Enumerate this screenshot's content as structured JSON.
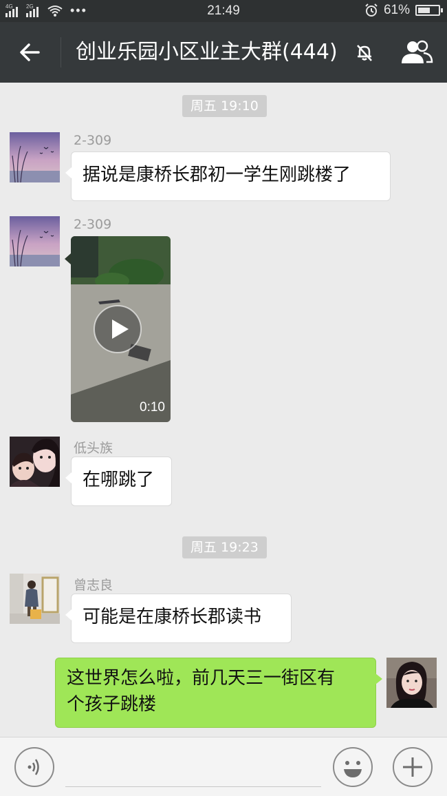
{
  "status_bar": {
    "net1": "4G",
    "net2": "2G",
    "more": "•••",
    "time": "21:49",
    "battery": "61%",
    "battery_level": 0.61
  },
  "header": {
    "title": "创业乐园小区业主大群(444)"
  },
  "timestamps": [
    "周五 19:10",
    "周五 19:23"
  ],
  "messages": [
    {
      "sender": "2-309",
      "text": "据说是康桥长郡初一学生刚跳楼了"
    },
    {
      "sender": "2-309",
      "video_duration": "0:10"
    },
    {
      "sender": "低头族",
      "text": "在哪跳了"
    },
    {
      "sender": "曾志良",
      "text": "可能是在康桥长郡读书"
    },
    {
      "sender": "",
      "text_line1": "这世界怎么啦，前几天三一街区有",
      "text_line2": "个孩子跳楼"
    }
  ],
  "colors": {
    "header_bg": "#35393b",
    "chat_bg": "#ebebeb",
    "my_bubble": "#9fe657",
    "other_bubble": "#ffffff"
  },
  "icons": [
    "back-arrow-icon",
    "mute-bell-icon",
    "group-members-icon",
    "play-icon",
    "voice-icon",
    "emoji-icon",
    "plus-icon"
  ]
}
